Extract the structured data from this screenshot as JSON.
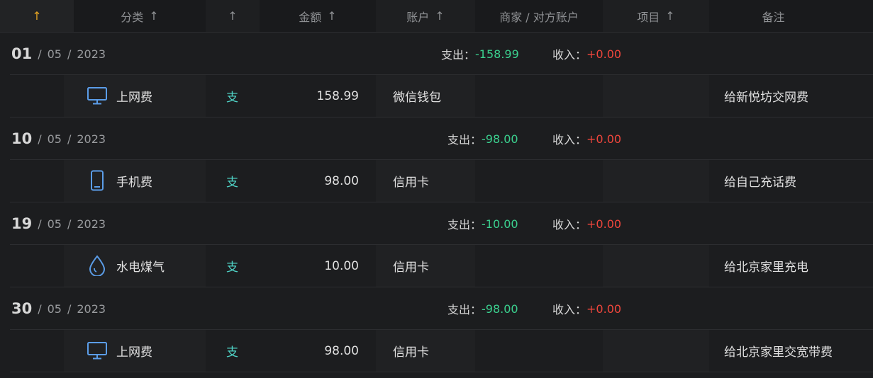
{
  "header": {
    "sort_arrow": "↑",
    "columns": [
      {
        "label": "分类",
        "arrow": "↑"
      },
      {
        "label": "",
        "arrow": "↑"
      },
      {
        "label": "金额",
        "arrow": "↑"
      },
      {
        "label": "账户",
        "arrow": "↑"
      },
      {
        "label": "商家 / 对方账户",
        "arrow": ""
      },
      {
        "label": "项目",
        "arrow": "↑"
      },
      {
        "label": "备注",
        "arrow": ""
      }
    ]
  },
  "summary_labels": {
    "expense": "支出：",
    "income": "收入："
  },
  "groups": [
    {
      "day": "01",
      "month": "05",
      "year": "2023",
      "sep": "/",
      "expense": "-158.99",
      "income": "+0.00",
      "item": {
        "icon": "monitor-icon",
        "category": "上网费",
        "type": "支",
        "amount": "158.99",
        "account": "微信钱包",
        "note": "给新悦坊交网费"
      }
    },
    {
      "day": "10",
      "month": "05",
      "year": "2023",
      "sep": "/",
      "expense": "-98.00",
      "income": "+0.00",
      "item": {
        "icon": "phone-icon",
        "category": "手机费",
        "type": "支",
        "amount": "98.00",
        "account": "信用卡",
        "note": "给自己充话费"
      }
    },
    {
      "day": "19",
      "month": "05",
      "year": "2023",
      "sep": "/",
      "expense": "-10.00",
      "income": "+0.00",
      "item": {
        "icon": "water-drop-icon",
        "category": "水电煤气",
        "type": "支",
        "amount": "10.00",
        "account": "信用卡",
        "note": "给北京家里充电"
      }
    },
    {
      "day": "30",
      "month": "05",
      "year": "2023",
      "sep": "/",
      "expense": "-98.00",
      "income": "+0.00",
      "item": {
        "icon": "monitor-icon",
        "category": "上网费",
        "type": "支",
        "amount": "98.00",
        "account": "信用卡",
        "note": "给北京家里交宽带费"
      }
    }
  ],
  "colors": {
    "accent": "#e3a323",
    "expense": "#3bd18f",
    "income": "#f0463c",
    "type": "#4fd3c6",
    "icon": "#5b9de8"
  }
}
